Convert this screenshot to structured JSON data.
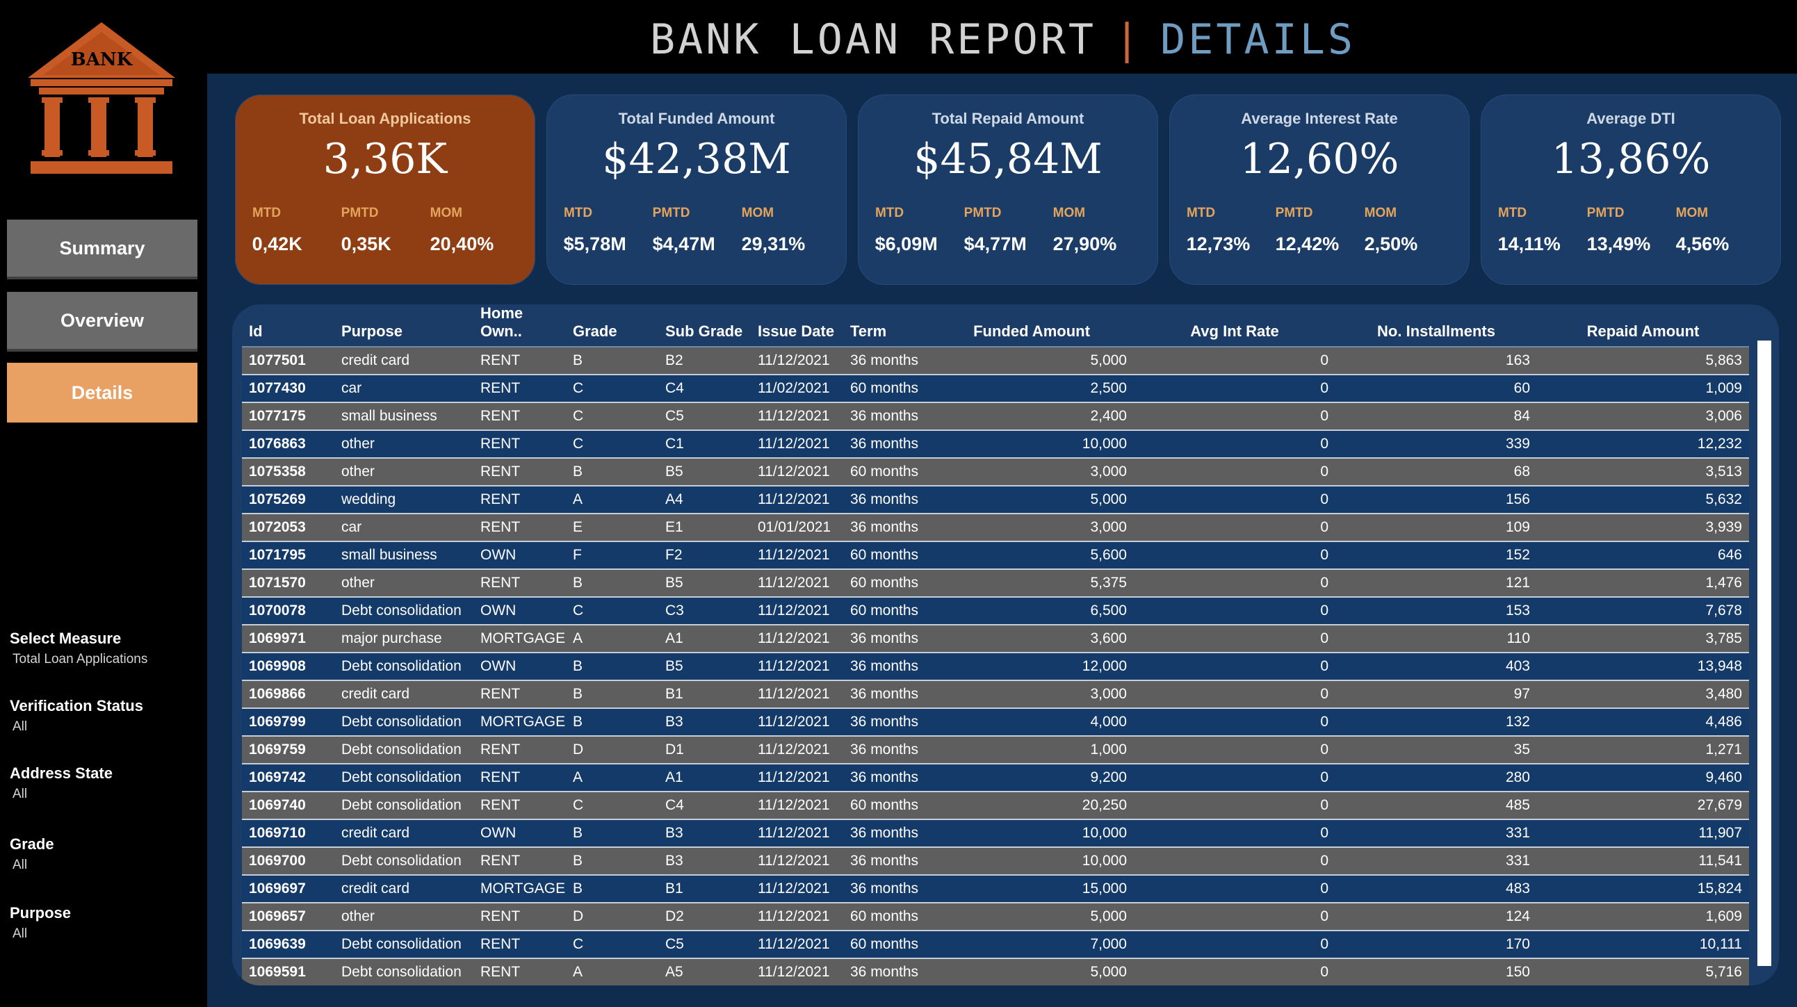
{
  "header": {
    "title_main": "BANK LOAN REPORT",
    "separator": "|",
    "title_sub": "DETAILS"
  },
  "logo": {
    "text": "BANK"
  },
  "nav": {
    "items": [
      {
        "label": "Summary"
      },
      {
        "label": "Overview"
      },
      {
        "label": "Details"
      }
    ],
    "active": "Details"
  },
  "filters": [
    {
      "label": "Select Measure",
      "value": "Total Loan Applications"
    },
    {
      "label": "Verification Status",
      "value": "All"
    },
    {
      "label": "Address State",
      "value": "All"
    },
    {
      "label": "Grade",
      "value": "All"
    },
    {
      "label": "Purpose",
      "value": "All"
    }
  ],
  "kpis": [
    {
      "title": "Total Loan Applications",
      "value": "3,36K",
      "mtd_label": "MTD",
      "mtd": "0,42K",
      "pmtd_label": "PMTD",
      "pmtd": "0,35K",
      "mom_label": "MOM",
      "mom": "20,40%"
    },
    {
      "title": "Total Funded Amount",
      "value": "$42,38M",
      "mtd_label": "MTD",
      "mtd": "$5,78M",
      "pmtd_label": "PMTD",
      "pmtd": "$4,47M",
      "mom_label": "MOM",
      "mom": "29,31%"
    },
    {
      "title": "Total Repaid Amount",
      "value": "$45,84M",
      "mtd_label": "MTD",
      "mtd": "$6,09M",
      "pmtd_label": "PMTD",
      "pmtd": "$4,77M",
      "mom_label": "MOM",
      "mom": "27,90%"
    },
    {
      "title": "Average Interest Rate",
      "value": "12,60%",
      "mtd_label": "MTD",
      "mtd": "12,73%",
      "pmtd_label": "PMTD",
      "pmtd": "12,42%",
      "mom_label": "MOM",
      "mom": "2,50%"
    },
    {
      "title": "Average DTI",
      "value": "13,86%",
      "mtd_label": "MTD",
      "mtd": "14,11%",
      "pmtd_label": "PMTD",
      "pmtd": "13,49%",
      "mom_label": "MOM",
      "mom": "4,56%"
    }
  ],
  "table": {
    "columns": [
      "Id",
      "Purpose",
      "Home Own..",
      "Grade",
      "Sub Grade",
      "Issue Date",
      "Term",
      "Funded Amount",
      "Avg Int Rate",
      "No. Installments",
      "Repaid Amount"
    ],
    "rows": [
      [
        "1077501",
        "credit card",
        "RENT",
        "B",
        "B2",
        "11/12/2021",
        "36 months",
        "5,000",
        "0",
        "163",
        "5,863"
      ],
      [
        "1077430",
        "car",
        "RENT",
        "C",
        "C4",
        "11/02/2021",
        "60 months",
        "2,500",
        "0",
        "60",
        "1,009"
      ],
      [
        "1077175",
        "small business",
        "RENT",
        "C",
        "C5",
        "11/12/2021",
        "36 months",
        "2,400",
        "0",
        "84",
        "3,006"
      ],
      [
        "1076863",
        "other",
        "RENT",
        "C",
        "C1",
        "11/12/2021",
        "36 months",
        "10,000",
        "0",
        "339",
        "12,232"
      ],
      [
        "1075358",
        "other",
        "RENT",
        "B",
        "B5",
        "11/12/2021",
        "60 months",
        "3,000",
        "0",
        "68",
        "3,513"
      ],
      [
        "1075269",
        "wedding",
        "RENT",
        "A",
        "A4",
        "11/12/2021",
        "36 months",
        "5,000",
        "0",
        "156",
        "5,632"
      ],
      [
        "1072053",
        "car",
        "RENT",
        "E",
        "E1",
        "01/01/2021",
        "36 months",
        "3,000",
        "0",
        "109",
        "3,939"
      ],
      [
        "1071795",
        "small business",
        "OWN",
        "F",
        "F2",
        "11/12/2021",
        "60 months",
        "5,600",
        "0",
        "152",
        "646"
      ],
      [
        "1071570",
        "other",
        "RENT",
        "B",
        "B5",
        "11/12/2021",
        "60 months",
        "5,375",
        "0",
        "121",
        "1,476"
      ],
      [
        "1070078",
        "Debt consolidation",
        "OWN",
        "C",
        "C3",
        "11/12/2021",
        "60 months",
        "6,500",
        "0",
        "153",
        "7,678"
      ],
      [
        "1069971",
        "major purchase",
        "MORTGAGE",
        "A",
        "A1",
        "11/12/2021",
        "36 months",
        "3,600",
        "0",
        "110",
        "3,785"
      ],
      [
        "1069908",
        "Debt consolidation",
        "OWN",
        "B",
        "B5",
        "11/12/2021",
        "36 months",
        "12,000",
        "0",
        "403",
        "13,948"
      ],
      [
        "1069866",
        "credit card",
        "RENT",
        "B",
        "B1",
        "11/12/2021",
        "36 months",
        "3,000",
        "0",
        "97",
        "3,480"
      ],
      [
        "1069799",
        "Debt consolidation",
        "MORTGAGE",
        "B",
        "B3",
        "11/12/2021",
        "36 months",
        "4,000",
        "0",
        "132",
        "4,486"
      ],
      [
        "1069759",
        "Debt consolidation",
        "RENT",
        "D",
        "D1",
        "11/12/2021",
        "36 months",
        "1,000",
        "0",
        "35",
        "1,271"
      ],
      [
        "1069742",
        "Debt consolidation",
        "RENT",
        "A",
        "A1",
        "11/12/2021",
        "36 months",
        "9,200",
        "0",
        "280",
        "9,460"
      ],
      [
        "1069740",
        "Debt consolidation",
        "RENT",
        "C",
        "C4",
        "11/12/2021",
        "60 months",
        "20,250",
        "0",
        "485",
        "27,679"
      ],
      [
        "1069710",
        "credit card",
        "OWN",
        "B",
        "B3",
        "11/12/2021",
        "36 months",
        "10,000",
        "0",
        "331",
        "11,907"
      ],
      [
        "1069700",
        "Debt consolidation",
        "RENT",
        "B",
        "B3",
        "11/12/2021",
        "36 months",
        "10,000",
        "0",
        "331",
        "11,541"
      ],
      [
        "1069697",
        "credit card",
        "MORTGAGE",
        "B",
        "B1",
        "11/12/2021",
        "36 months",
        "15,000",
        "0",
        "483",
        "15,824"
      ],
      [
        "1069657",
        "other",
        "RENT",
        "D",
        "D2",
        "11/12/2021",
        "60 months",
        "5,000",
        "0",
        "124",
        "1,609"
      ],
      [
        "1069639",
        "Debt consolidation",
        "RENT",
        "C",
        "C5",
        "11/12/2021",
        "60 months",
        "7,000",
        "0",
        "170",
        "10,111"
      ],
      [
        "1069591",
        "Debt consolidation",
        "RENT",
        "A",
        "A5",
        "11/12/2021",
        "36 months",
        "5,000",
        "0",
        "150",
        "5,716"
      ]
    ]
  }
}
